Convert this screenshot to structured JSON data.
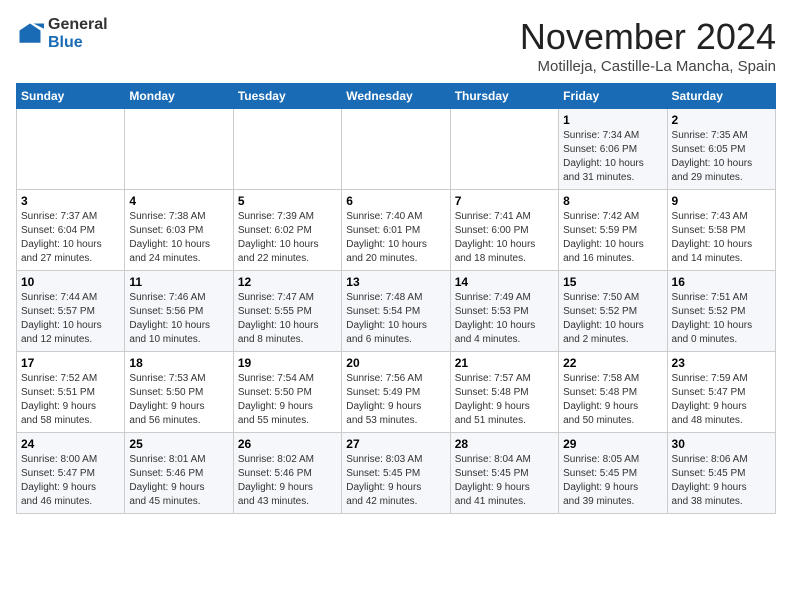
{
  "header": {
    "logo_line1": "General",
    "logo_line2": "Blue",
    "month": "November 2024",
    "location": "Motilleja, Castille-La Mancha, Spain"
  },
  "weekdays": [
    "Sunday",
    "Monday",
    "Tuesday",
    "Wednesday",
    "Thursday",
    "Friday",
    "Saturday"
  ],
  "weeks": [
    [
      {
        "day": "",
        "info": ""
      },
      {
        "day": "",
        "info": ""
      },
      {
        "day": "",
        "info": ""
      },
      {
        "day": "",
        "info": ""
      },
      {
        "day": "",
        "info": ""
      },
      {
        "day": "1",
        "info": "Sunrise: 7:34 AM\nSunset: 6:06 PM\nDaylight: 10 hours\nand 31 minutes."
      },
      {
        "day": "2",
        "info": "Sunrise: 7:35 AM\nSunset: 6:05 PM\nDaylight: 10 hours\nand 29 minutes."
      }
    ],
    [
      {
        "day": "3",
        "info": "Sunrise: 7:37 AM\nSunset: 6:04 PM\nDaylight: 10 hours\nand 27 minutes."
      },
      {
        "day": "4",
        "info": "Sunrise: 7:38 AM\nSunset: 6:03 PM\nDaylight: 10 hours\nand 24 minutes."
      },
      {
        "day": "5",
        "info": "Sunrise: 7:39 AM\nSunset: 6:02 PM\nDaylight: 10 hours\nand 22 minutes."
      },
      {
        "day": "6",
        "info": "Sunrise: 7:40 AM\nSunset: 6:01 PM\nDaylight: 10 hours\nand 20 minutes."
      },
      {
        "day": "7",
        "info": "Sunrise: 7:41 AM\nSunset: 6:00 PM\nDaylight: 10 hours\nand 18 minutes."
      },
      {
        "day": "8",
        "info": "Sunrise: 7:42 AM\nSunset: 5:59 PM\nDaylight: 10 hours\nand 16 minutes."
      },
      {
        "day": "9",
        "info": "Sunrise: 7:43 AM\nSunset: 5:58 PM\nDaylight: 10 hours\nand 14 minutes."
      }
    ],
    [
      {
        "day": "10",
        "info": "Sunrise: 7:44 AM\nSunset: 5:57 PM\nDaylight: 10 hours\nand 12 minutes."
      },
      {
        "day": "11",
        "info": "Sunrise: 7:46 AM\nSunset: 5:56 PM\nDaylight: 10 hours\nand 10 minutes."
      },
      {
        "day": "12",
        "info": "Sunrise: 7:47 AM\nSunset: 5:55 PM\nDaylight: 10 hours\nand 8 minutes."
      },
      {
        "day": "13",
        "info": "Sunrise: 7:48 AM\nSunset: 5:54 PM\nDaylight: 10 hours\nand 6 minutes."
      },
      {
        "day": "14",
        "info": "Sunrise: 7:49 AM\nSunset: 5:53 PM\nDaylight: 10 hours\nand 4 minutes."
      },
      {
        "day": "15",
        "info": "Sunrise: 7:50 AM\nSunset: 5:52 PM\nDaylight: 10 hours\nand 2 minutes."
      },
      {
        "day": "16",
        "info": "Sunrise: 7:51 AM\nSunset: 5:52 PM\nDaylight: 10 hours\nand 0 minutes."
      }
    ],
    [
      {
        "day": "17",
        "info": "Sunrise: 7:52 AM\nSunset: 5:51 PM\nDaylight: 9 hours\nand 58 minutes."
      },
      {
        "day": "18",
        "info": "Sunrise: 7:53 AM\nSunset: 5:50 PM\nDaylight: 9 hours\nand 56 minutes."
      },
      {
        "day": "19",
        "info": "Sunrise: 7:54 AM\nSunset: 5:50 PM\nDaylight: 9 hours\nand 55 minutes."
      },
      {
        "day": "20",
        "info": "Sunrise: 7:56 AM\nSunset: 5:49 PM\nDaylight: 9 hours\nand 53 minutes."
      },
      {
        "day": "21",
        "info": "Sunrise: 7:57 AM\nSunset: 5:48 PM\nDaylight: 9 hours\nand 51 minutes."
      },
      {
        "day": "22",
        "info": "Sunrise: 7:58 AM\nSunset: 5:48 PM\nDaylight: 9 hours\nand 50 minutes."
      },
      {
        "day": "23",
        "info": "Sunrise: 7:59 AM\nSunset: 5:47 PM\nDaylight: 9 hours\nand 48 minutes."
      }
    ],
    [
      {
        "day": "24",
        "info": "Sunrise: 8:00 AM\nSunset: 5:47 PM\nDaylight: 9 hours\nand 46 minutes."
      },
      {
        "day": "25",
        "info": "Sunrise: 8:01 AM\nSunset: 5:46 PM\nDaylight: 9 hours\nand 45 minutes."
      },
      {
        "day": "26",
        "info": "Sunrise: 8:02 AM\nSunset: 5:46 PM\nDaylight: 9 hours\nand 43 minutes."
      },
      {
        "day": "27",
        "info": "Sunrise: 8:03 AM\nSunset: 5:45 PM\nDaylight: 9 hours\nand 42 minutes."
      },
      {
        "day": "28",
        "info": "Sunrise: 8:04 AM\nSunset: 5:45 PM\nDaylight: 9 hours\nand 41 minutes."
      },
      {
        "day": "29",
        "info": "Sunrise: 8:05 AM\nSunset: 5:45 PM\nDaylight: 9 hours\nand 39 minutes."
      },
      {
        "day": "30",
        "info": "Sunrise: 8:06 AM\nSunset: 5:45 PM\nDaylight: 9 hours\nand 38 minutes."
      }
    ]
  ]
}
